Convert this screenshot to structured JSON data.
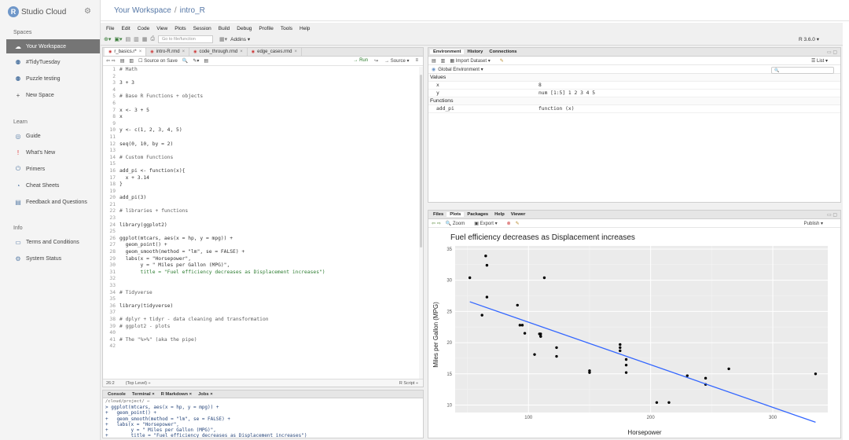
{
  "brand": {
    "logo_letter": "R",
    "name": "Studio Cloud"
  },
  "workspace": {
    "breadcrumb_root": "Your Workspace",
    "separator": "/",
    "project": "intro_R"
  },
  "sidebar": {
    "spaces_heading": "Spaces",
    "spaces": [
      {
        "label": "Your Workspace",
        "icon": "cloud-icon",
        "active": true
      },
      {
        "label": "#TidyTuesday",
        "icon": "people-icon"
      },
      {
        "label": "Puzzle testing",
        "icon": "people-icon"
      },
      {
        "label": "New Space",
        "icon": "plus-icon"
      }
    ],
    "learn_heading": "Learn",
    "learn": [
      {
        "label": "Guide",
        "icon": "compass-icon"
      },
      {
        "label": "What's New",
        "icon": "exclamation-icon"
      },
      {
        "label": "Primers",
        "icon": "power-icon"
      },
      {
        "label": "Cheat Sheets",
        "icon": "cheatsheet-icon"
      },
      {
        "label": "Feedback and Questions",
        "icon": "feedback-icon"
      }
    ],
    "info_heading": "Info",
    "info": [
      {
        "label": "Terms and Conditions",
        "icon": "document-icon"
      },
      {
        "label": "System Status",
        "icon": "status-icon"
      }
    ]
  },
  "menu": [
    "File",
    "Edit",
    "Code",
    "View",
    "Plots",
    "Session",
    "Build",
    "Debug",
    "Profile",
    "Tools",
    "Help"
  ],
  "toolbar": {
    "goto_placeholder": "Go to file/function",
    "addins": "Addins ▾",
    "r_version": "R 3.6.0 ▾"
  },
  "editor": {
    "tabs": [
      {
        "label": "r_basics.r*",
        "active": true
      },
      {
        "label": "intro-R.rmd"
      },
      {
        "label": "code_through.rmd"
      },
      {
        "label": "edge_cases.rmd"
      }
    ],
    "source_on_save": "Source on Save",
    "run": "→ Run",
    "source": "→ Source ▾",
    "lines": [
      {
        "n": "1",
        "t": "# Math",
        "k": "cmt"
      },
      {
        "n": "2",
        "t": ""
      },
      {
        "n": "3",
        "t": "3 + 3"
      },
      {
        "n": "4",
        "t": ""
      },
      {
        "n": "5",
        "t": "# Base R Functions + objects",
        "k": "cmt"
      },
      {
        "n": "6",
        "t": ""
      },
      {
        "n": "7",
        "t": "x <- 3 + 5"
      },
      {
        "n": "8",
        "t": "x"
      },
      {
        "n": "9",
        "t": ""
      },
      {
        "n": "10",
        "t": "y <- c(1, 2, 3, 4, 5)"
      },
      {
        "n": "11",
        "t": ""
      },
      {
        "n": "12",
        "t": "seq(0, 10, by = 2)"
      },
      {
        "n": "13",
        "t": ""
      },
      {
        "n": "14",
        "t": "# Custom Functions",
        "k": "cmt"
      },
      {
        "n": "15",
        "t": ""
      },
      {
        "n": "16",
        "t": "add_pi <- function(x){"
      },
      {
        "n": "17",
        "t": "  x + 3.14"
      },
      {
        "n": "18",
        "t": "}"
      },
      {
        "n": "19",
        "t": ""
      },
      {
        "n": "20",
        "t": "add_pi(3)"
      },
      {
        "n": "21",
        "t": ""
      },
      {
        "n": "22",
        "t": "# libraries + functions",
        "k": "cmt"
      },
      {
        "n": "23",
        "t": ""
      },
      {
        "n": "24",
        "t": "library(ggplot2)"
      },
      {
        "n": "25",
        "t": ""
      },
      {
        "n": "26",
        "t": "ggplot(mtcars, aes(x = hp, y = mpg)) +"
      },
      {
        "n": "27",
        "t": "  geom_point() +"
      },
      {
        "n": "28",
        "t": "  geom_smooth(method = \"lm\", se = FALSE) +"
      },
      {
        "n": "29",
        "t": "  labs(x = \"Horsepower\","
      },
      {
        "n": "30",
        "t": "       y = \" Miles per Gallon (MPG)\","
      },
      {
        "n": "31",
        "t": "       title = \"Fuel efficiency decreases as Displacement increases\")",
        "k": "str"
      },
      {
        "n": "32",
        "t": ""
      },
      {
        "n": "33",
        "t": ""
      },
      {
        "n": "34",
        "t": "# Tidyverse",
        "k": "cmt"
      },
      {
        "n": "35",
        "t": ""
      },
      {
        "n": "36",
        "t": "library(tidyverse)"
      },
      {
        "n": "37",
        "t": ""
      },
      {
        "n": "38",
        "t": "# dplyr + tidyr - data cleaning and transformation",
        "k": "cmt"
      },
      {
        "n": "39",
        "t": "# ggplot2 - plots",
        "k": "cmt"
      },
      {
        "n": "40",
        "t": ""
      },
      {
        "n": "41",
        "t": "# The \"%>%\" (aka the pipe)",
        "k": "cmt"
      },
      {
        "n": "42",
        "t": ""
      }
    ],
    "status_pos": "26:2",
    "status_level": "(Top Level) ÷",
    "status_type": "R Script ÷"
  },
  "console": {
    "tabs": [
      "Console",
      "Terminal ×",
      "R Markdown ×",
      "Jobs ×"
    ],
    "path": "/cloud/project/ ⇨",
    "lines": [
      "> ggplot(mtcars, aes(x = hp, y = mpg)) +",
      "+   geom_point() +",
      "+   geom_smooth(method = \"lm\", se = FALSE) +",
      "+   labs(x = \"Horsepower\",",
      "+        y = \" Miles per Gallon (MPG)\",",
      "+        title = \"Fuel efficiency decreases as Displacement increases\")",
      "+ "
    ]
  },
  "environment": {
    "tabs": [
      "Environment",
      "History",
      "Connections"
    ],
    "import_dataset": "Import Dataset ▾",
    "list_view": "☰ List ▾",
    "scope": "Global Environment ▾",
    "values_heading": "Values",
    "values": [
      {
        "name": "x",
        "value": "8"
      },
      {
        "name": "y",
        "value": "num [1:5] 1 2 3 4 5"
      }
    ],
    "functions_heading": "Functions",
    "functions": [
      {
        "name": "add_pi",
        "value": "function (x)"
      }
    ]
  },
  "plots": {
    "tabs": [
      "Files",
      "Plots",
      "Packages",
      "Help",
      "Viewer"
    ],
    "zoom": "Zoom",
    "export": "Export ▾",
    "publish": "Publish ▾"
  },
  "chart_data": {
    "type": "scatter",
    "title": "Fuel efficiency decreases as Displacement increases",
    "xlabel": "Horsepower",
    "ylabel": "Miles per Gallon (MPG)",
    "xlim": [
      40,
      345
    ],
    "ylim": [
      8.8,
      35.5
    ],
    "xticks": [
      100,
      200,
      300
    ],
    "yticks": [
      10,
      15,
      20,
      25,
      30,
      35
    ],
    "grid": true,
    "points": [
      [
        110,
        21.0
      ],
      [
        110,
        21.0
      ],
      [
        93,
        22.8
      ],
      [
        110,
        21.4
      ],
      [
        175,
        18.7
      ],
      [
        105,
        18.1
      ],
      [
        245,
        14.3
      ],
      [
        62,
        24.4
      ],
      [
        95,
        22.8
      ],
      [
        123,
        19.2
      ],
      [
        123,
        17.8
      ],
      [
        180,
        16.4
      ],
      [
        180,
        17.3
      ],
      [
        180,
        15.2
      ],
      [
        205,
        10.4
      ],
      [
        215,
        10.4
      ],
      [
        230,
        14.7
      ],
      [
        66,
        32.4
      ],
      [
        52,
        30.4
      ],
      [
        65,
        33.9
      ],
      [
        97,
        21.5
      ],
      [
        150,
        15.5
      ],
      [
        150,
        15.2
      ],
      [
        245,
        13.3
      ],
      [
        175,
        19.2
      ],
      [
        66,
        27.3
      ],
      [
        91,
        26.0
      ],
      [
        113,
        30.4
      ],
      [
        264,
        15.8
      ],
      [
        175,
        19.7
      ],
      [
        335,
        15.0
      ],
      [
        109,
        21.4
      ]
    ],
    "fit_line": {
      "x": [
        52,
        335
      ],
      "y": [
        26.55,
        7.24
      ]
    },
    "colors": {
      "panel": "#ebebeb",
      "grid": "#ffffff",
      "points": "#000000",
      "fit": "#3366ff"
    }
  }
}
